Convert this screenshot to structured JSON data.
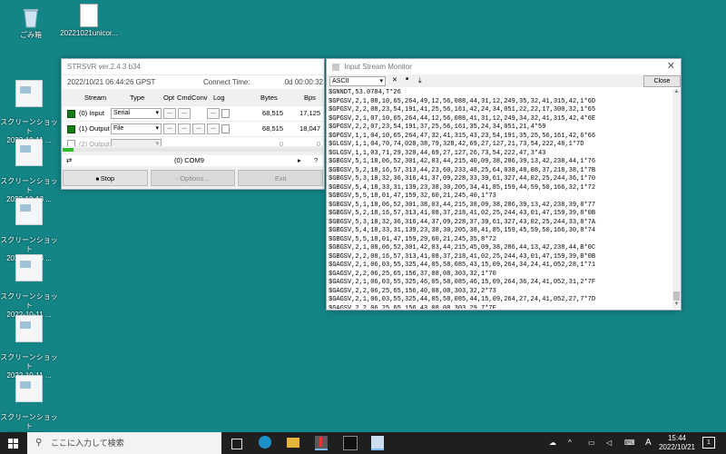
{
  "desktop": {
    "icons": [
      {
        "label": "ごみ箱",
        "type": "recycle"
      },
      {
        "label": "20221021unicor...",
        "type": "doc"
      },
      {
        "label": "スクリーンショット\n2022-10-11 ...",
        "type": "thumb"
      },
      {
        "label": "スクリーンショット\n2022-10-13 ...",
        "type": "thumb"
      },
      {
        "label": "スクリーンショット\n2022-10-13 ...",
        "type": "thumb"
      },
      {
        "label": "スクリーンショット\n2022-10-11 ...",
        "type": "thumb"
      },
      {
        "label": "スクリーンショット\n2022-10-11 ...",
        "type": "thumb"
      },
      {
        "label": "スクリーンショット\n2022-10-11 ...",
        "type": "thumb"
      }
    ]
  },
  "strsvr": {
    "title": "STRSVR ver.2.4.3 b34",
    "datetime": "2022/10/21 06:44:26 GPST",
    "connect_label": "Connect Time:",
    "connect_time": "0d 00:00:32",
    "headers": {
      "stream": "Stream",
      "type": "Type",
      "opt": "Opt",
      "cmd": "Cmd",
      "conv": "Conv",
      "log": "Log",
      "bytes": "Bytes",
      "bps": "Bps"
    },
    "rows": [
      {
        "stream": "(0) Input",
        "type": "Serial",
        "bytes": "68,515",
        "bps": "17,125"
      },
      {
        "stream": "(1) Output",
        "type": "File",
        "bytes": "68,515",
        "bps": "18,047"
      },
      {
        "stream": "(2) Output",
        "type": "",
        "bytes": "0",
        "bps": "0"
      }
    ],
    "status_msg": "(0) COM9",
    "buttons": {
      "stop": "Stop",
      "options": "Options...",
      "exit": "Exit"
    },
    "btn_dots": "...",
    "status_arrow": "⇄",
    "status_question": "?"
  },
  "monitor": {
    "title": "Input Stream Monitor",
    "format": "ASCII",
    "close_label": "Close",
    "tool_icons": {
      "clear": "✕",
      "pause": "■",
      "down": "⤓"
    },
    "lines": [
      "$GNNDT,53.0784,T*26",
      "$GPGSV,2,1,08,10,65,264,49,12,56,088,44,31,12,249,35,32,41,315,42,1*6D",
      "$GPGSV,2,2,08,23,54,191,41,25,56,161,42,24,34,051,22,22,17,300,32,1*65",
      "$GPGSV,2,1,07,10,65,264,44,12,56,088,41,31,12,249,34,32,41,315,42,4*6E",
      "$GPGSV,2,2,07,23,54,191,37,25,56,161,35,24,34,051,21,4*59",
      "$GPGSV,1,1,04,10,65,264,47,32,41,315,43,23,54,191,35,25,56,161,42,6*66",
      "$GLGSV,1,1,04,70,74,028,38,79,328,42,69,27,127,21,73,54,222,48,1*7D",
      "$GLGSV,1,1,03,71,29,328,44,69,27,127,26,73,54,222,47,3*43",
      "$GBGSV,5,1,18,06,52,301,42,03,44,215,40,09,38,286,39,13,42,238,44,1*76",
      "$GBGSV,5,2,18,16,57,313,44,23,60,233,48,25,64,038,48,08,37,218,38,1*7B",
      "$GBGSV,5,3,18,32,36,316,41,37,09,228,33,39,61,327,44,02,25,244,36,1*70",
      "$GBGSV,5,4,18,33,31,139,23,38,30,205,34,41,85,159,44,59,50,166,32,1*72",
      "$GBGSV,5,5,18,01,47,159,32,60,21,245,40,1*73",
      "$GBGSV,5,1,18,06,52,301,38,03,44,215,38,09,38,286,39,13,42,238,39,8*77",
      "$GBGSV,5,2,18,16,57,313,41,08,37,218,41,02,25,244,43,01,47,159,39,8*0B",
      "$GBGSV,5,3,18,32,36,316,44,37,09,228,37,39,61,327,43,02,25,244,33,8*7A",
      "$GBGSV,5,4,18,33,31,139,23,38,30,205,38,41,85,159,45,59,50,166,30,8*74",
      "$GBGSV,5,5,18,01,47,159,29,60,21,245,35,8*72",
      "$GBGSV,2,1,08,06,52,301,42,03,44,215,45,09,38,286,44,13,42,238,44,B*0C",
      "$GBGSV,2,2,08,16,57,313,41,08,37,218,41,02,25,244,43,01,47,159,39,B*0B",
      "$GAGSV,2,1,06,03,55,325,44,05,58,085,43,15,09,264,34,24,41,052,28,1*71",
      "$GAGSV,2,2,06,25,65,156,37,08,08,303,32,1*70",
      "$GAGSV,2,1,06,03,55,325,46,05,58,085,46,15,09,264,36,24,41,052,31,2*7F",
      "$GAGSV,2,2,06,25,65,156,40,08,08,303,32,2*73",
      "$GAGSV,2,1,06,03,55,325,44,05,58,085,44,15,09,264,27,24,41,052,27,7*7D",
      "$GAGSV,2,2,06,25,65,156,43,08,08,303,29,7*7F",
      "$GQGSV,1,1,02,02,58,155,41,07,49,189,34,1*61",
      "$GQGSV,1,1,02,02,58,155,37,07,49,189,36,6*65",
      "$GQGSV,1,1,02,02,58,155,36,07,49,189,36,8*6A"
    ]
  },
  "taskbar": {
    "search_placeholder": "ここに入力して検索",
    "ime": "A",
    "time": "15:44",
    "date": "2022/10/21",
    "notification_count": "1"
  }
}
